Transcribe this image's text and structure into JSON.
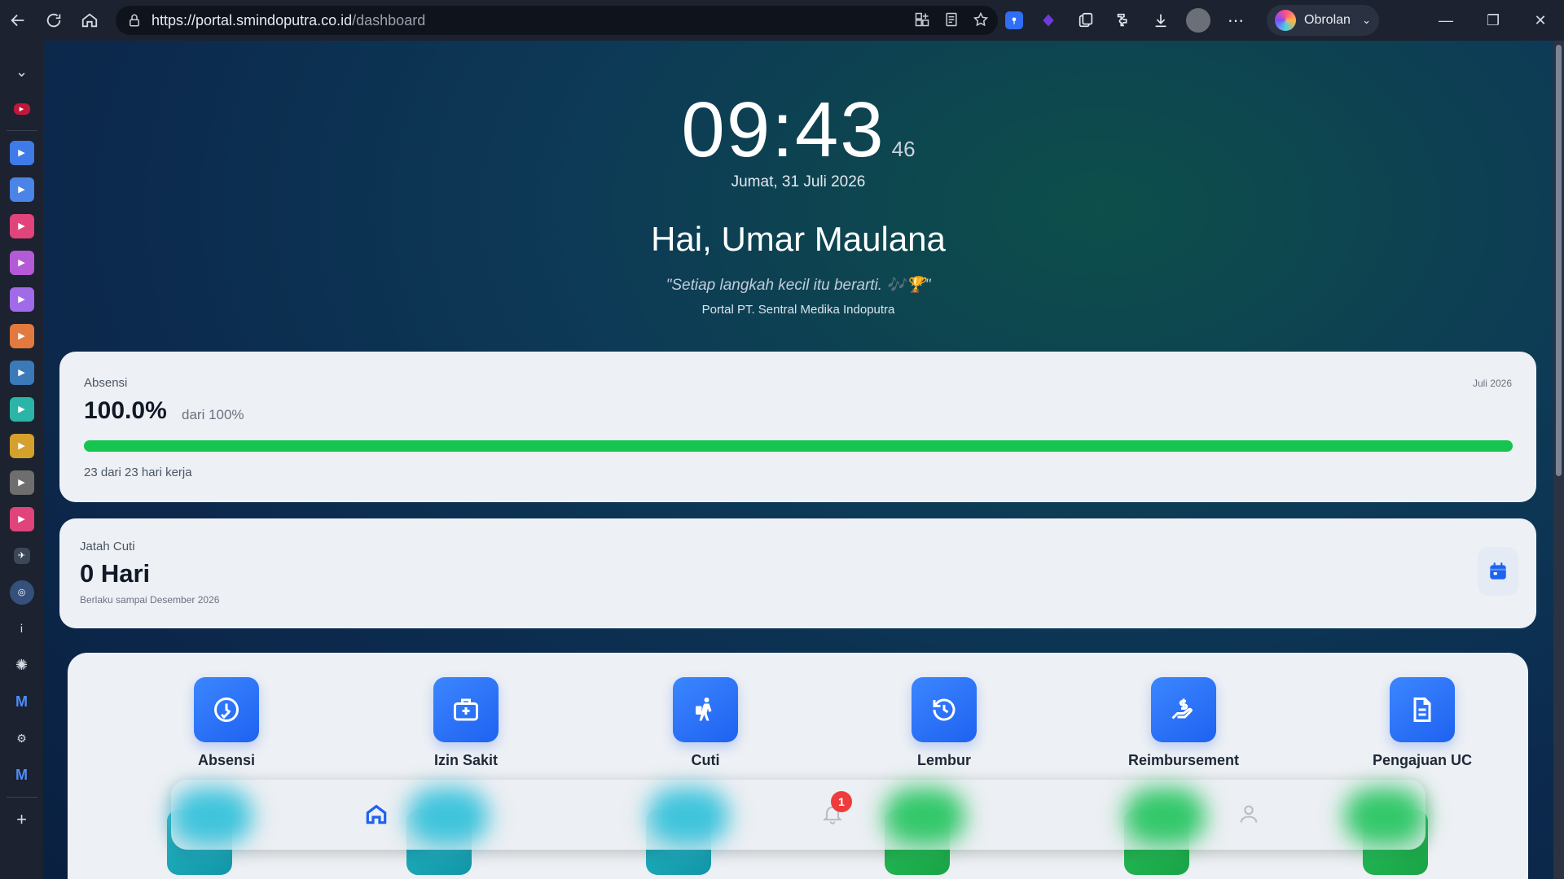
{
  "browser": {
    "url_host": "https://portal.smindoputra.co.id",
    "url_path": "/dashboard",
    "profile_label": "Obrolan"
  },
  "clock": {
    "time": "09:43",
    "seconds": "46",
    "date": "Jumat, 31 Juli 2026"
  },
  "greeting": "Hai, Umar Maulana",
  "quote": "\"Setiap langkah kecil itu berarti. 🎶🏆\"",
  "company": "Portal PT. Sentral Medika Indoputra",
  "attendance": {
    "label": "Absensi",
    "month": "Juli 2026",
    "percent": "100.0%",
    "of_text": "dari 100%",
    "progress": 1.0,
    "days_text": "23 dari 23 hari kerja"
  },
  "leave": {
    "label": "Jatah Cuti",
    "value": "0 Hari",
    "valid_until": "Berlaku sampai Desember 2026"
  },
  "menu": [
    {
      "label": "Absensi",
      "icon": "clock-check-icon"
    },
    {
      "label": "Izin Sakit",
      "icon": "medical-bag-icon"
    },
    {
      "label": "Cuti",
      "icon": "traveler-icon"
    },
    {
      "label": "Lembur",
      "icon": "history-icon"
    },
    {
      "label": "Reimbursement",
      "icon": "money-hand-icon"
    },
    {
      "label": "Pengajuan UC",
      "icon": "document-icon"
    }
  ],
  "bottom_nav": {
    "notification_count": "1"
  },
  "colors": {
    "accent": "#1e62f0",
    "success": "#16c450",
    "badge": "#ef3b3b"
  }
}
